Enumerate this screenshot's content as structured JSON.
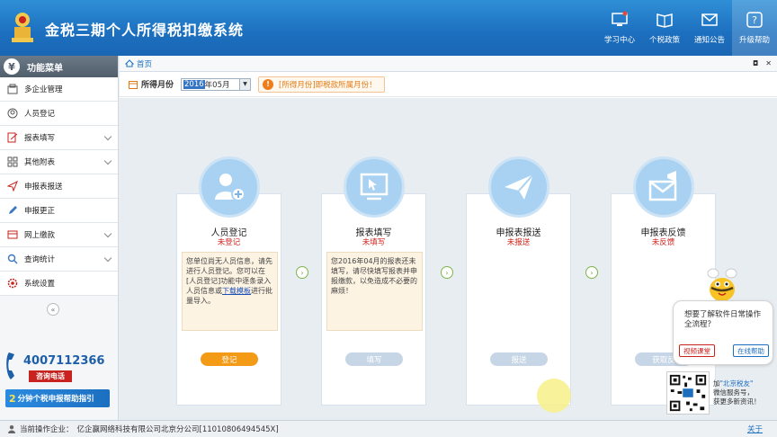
{
  "header": {
    "title": "金税三期个人所得税扣缴系统",
    "nav": [
      {
        "label": "学习中心",
        "icon": "monitor-icon"
      },
      {
        "label": "个税政策",
        "icon": "book-icon"
      },
      {
        "label": "通知公告",
        "icon": "mail-icon"
      },
      {
        "label": "升级帮助",
        "icon": "help-icon"
      }
    ]
  },
  "sidebar": {
    "head": "功能菜单",
    "head_glyph": "¥",
    "items": [
      {
        "label": "多企业管理"
      },
      {
        "label": "人员登记"
      },
      {
        "label": "报表填写"
      },
      {
        "label": "其他附表"
      },
      {
        "label": "申报表报送"
      },
      {
        "label": "申报更正"
      },
      {
        "label": "网上缴款"
      },
      {
        "label": "查询统计"
      },
      {
        "label": "系统设置"
      }
    ],
    "hotline_number": "4007112366",
    "hotline_label": "咨询电话",
    "guide_prefix": "2",
    "guide_text": "分钟个税申报帮助指引"
  },
  "tab": {
    "home": "首页"
  },
  "period": {
    "label": "所得月份",
    "value_year": "2016",
    "value_rest": "年05月",
    "tip": "[所得月份]即税款所属月份！"
  },
  "cards": [
    {
      "title": "人员登记",
      "status": "未登记",
      "desc_a": "您单位尚无人员信息，请先进行人员登记。您可以在[人员登记]功能中逐条录入人员信息或",
      "desc_link": "下载模板",
      "desc_b": "进行批量导入。",
      "action": "登记"
    },
    {
      "title": "报表填写",
      "status": "未填写",
      "desc_a": "您2016年04月的报表还未填写，请尽快填写报表并申报缴款，以免造成不必要的麻烦！",
      "desc_link": "",
      "desc_b": "",
      "action": "填写"
    },
    {
      "title": "申报表报送",
      "status": "未报送",
      "desc_a": "",
      "desc_link": "",
      "desc_b": "",
      "action": "报送"
    },
    {
      "title": "申报表反馈",
      "status": "未反馈",
      "desc_a": "",
      "desc_link": "",
      "desc_b": "",
      "action": "获取反"
    }
  ],
  "assistant": {
    "question": "想要了解软件日常操作全流程？",
    "btn_course": "视频课堂",
    "btn_help": "在线帮助",
    "qr_line1_a": "加",
    "qr_line1_b": "\"北京税友\"",
    "qr_line2": "微信服务号，",
    "qr_line3": "获更多新资讯！"
  },
  "statusbar": {
    "label": "当前操作企业：",
    "company": "亿企赢网络科技有限公司北京分公司[11010806494545X]",
    "about": "关于"
  },
  "colors": {
    "brand": "#1c6fbf",
    "accent": "#f39a16",
    "alert": "#d1201a"
  }
}
